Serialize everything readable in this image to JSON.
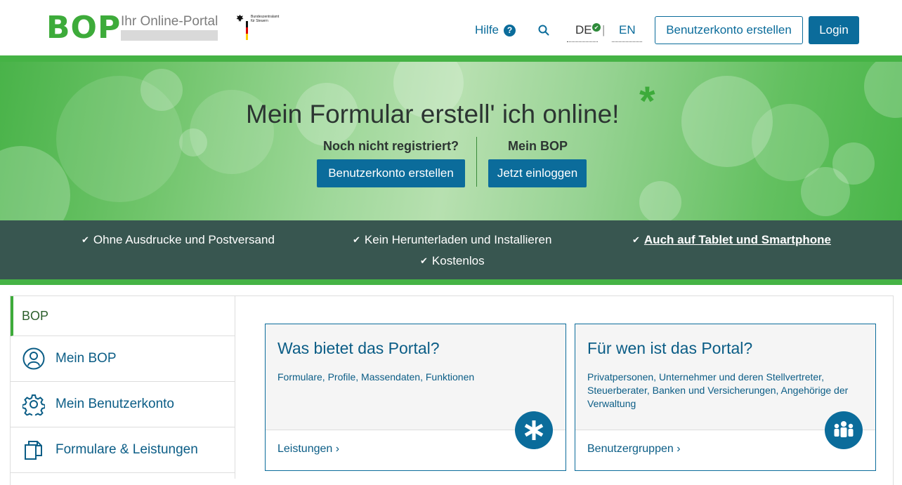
{
  "header": {
    "logo": "BOP",
    "logo_subtitle": "Ihr Online-Portal",
    "agency_text": "Bundeszentralamt\nfür Steuern",
    "help_label": "Hilfe",
    "help_icon": "question-circle-icon",
    "search_icon": "search-icon",
    "lang_de": "DE",
    "lang_separator": "|",
    "lang_en": "EN",
    "register_button": "Benutzerkonto erstellen",
    "login_button": "Login"
  },
  "hero": {
    "title": "Mein Formular erstell' ich online!",
    "star": "*",
    "left_label": "Noch nicht registriert?",
    "left_button": "Benutzerkonto erstellen",
    "right_label": "Mein BOP",
    "right_button": "Jetzt einloggen"
  },
  "features": [
    "Ohne Ausdrucke und Postversand",
    "Kein Herunterladen und Installieren",
    "Auch auf Tablet und Smartphone",
    "Kostenlos"
  ],
  "sidebar": {
    "heading": "BOP",
    "items": [
      {
        "label": "Mein BOP",
        "icon": "user-icon"
      },
      {
        "label": "Mein Benutzerkonto",
        "icon": "gear-icon"
      },
      {
        "label": "Formulare & Leistungen",
        "icon": "documents-icon"
      }
    ]
  },
  "cards": [
    {
      "title": "Was bietet das Portal?",
      "description": "Formulare, Profile, Massendaten, Funktionen",
      "link": "Leistungen ›",
      "icon": "asterisk-icon"
    },
    {
      "title": "Für wen ist das Portal?",
      "description": "Privatpersonen, Unternehmer und deren Stellvertreter, Steuerberater, Banken und Versicherungen, Angehörige der Verwaltung",
      "link": "Benutzergruppen ›",
      "icon": "people-group-icon"
    }
  ],
  "colors": {
    "brand_green": "#3dab3a",
    "primary_blue": "#0b6c9b",
    "feature_band": "#385650"
  }
}
